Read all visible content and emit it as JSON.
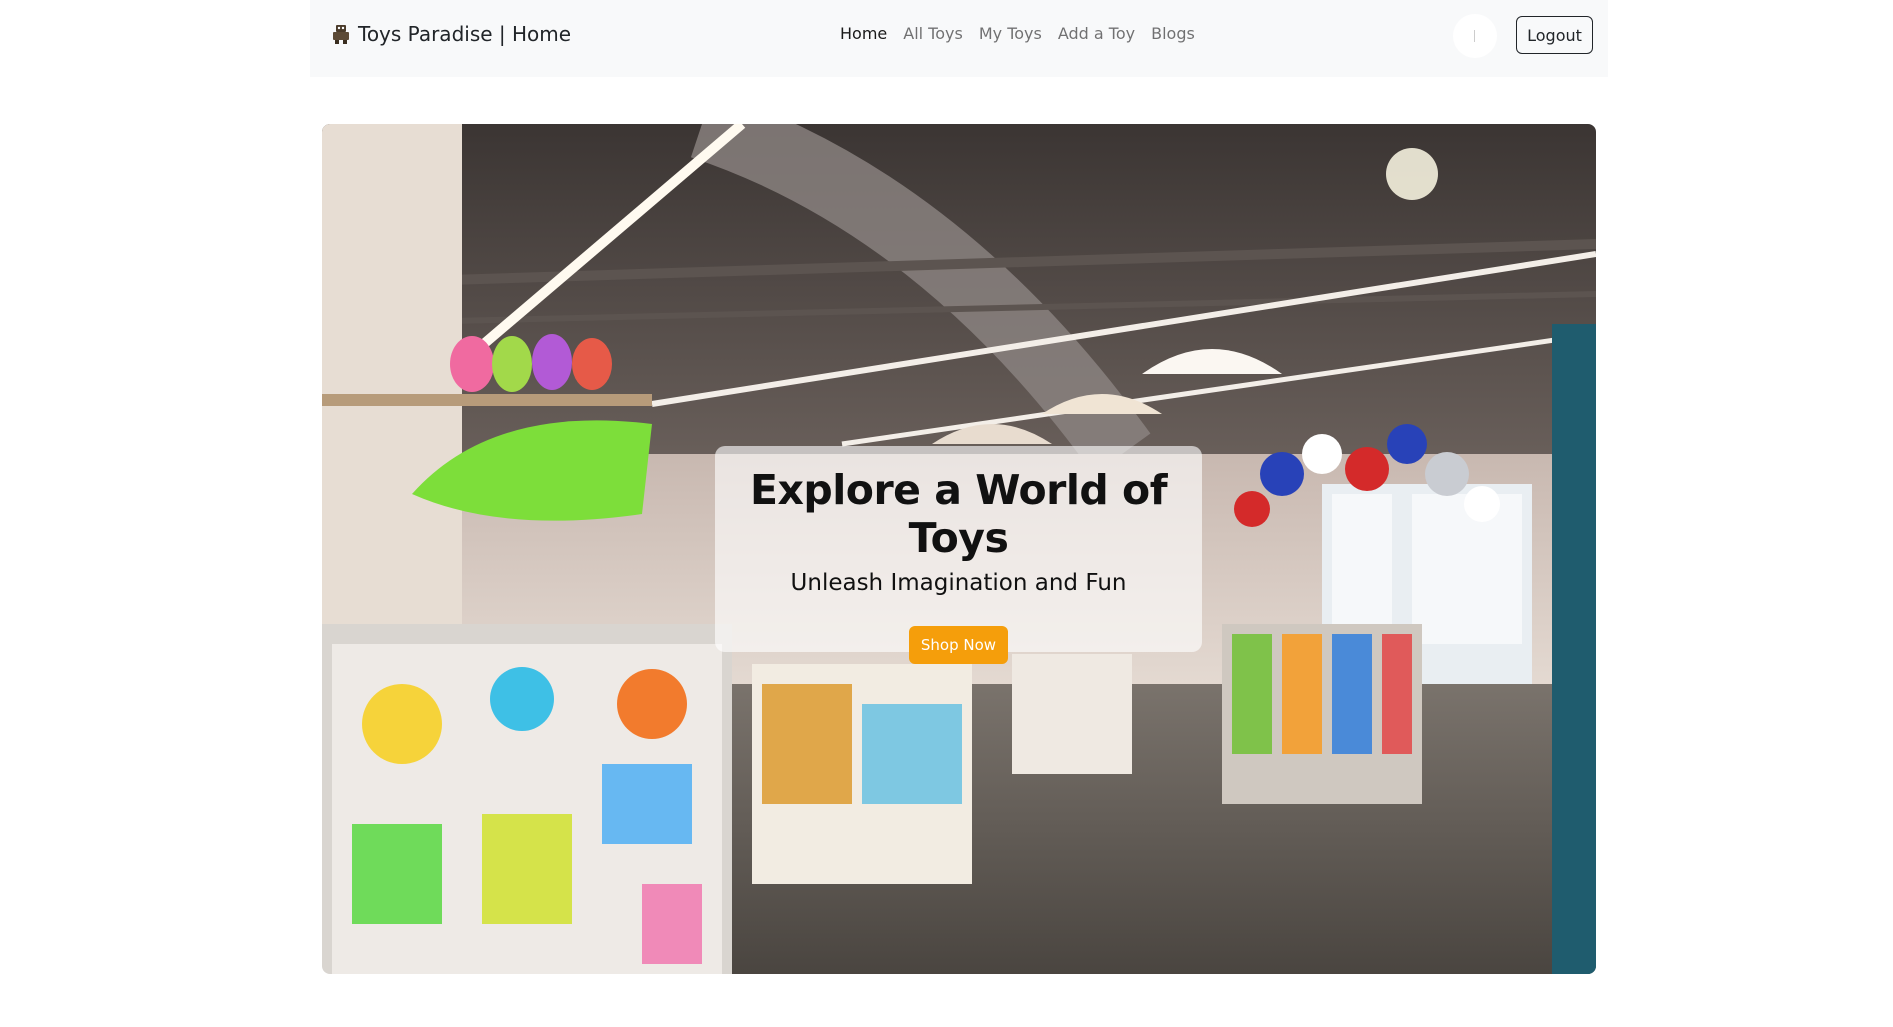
{
  "navbar": {
    "brand": "Toys Paradise | Home",
    "brand_icon": "toy-robot-icon",
    "links": [
      {
        "label": "Home",
        "active": true
      },
      {
        "label": "All Toys",
        "active": false
      },
      {
        "label": "My Toys",
        "active": false
      },
      {
        "label": "Add a Toy",
        "active": false
      },
      {
        "label": "Blogs",
        "active": false
      }
    ],
    "logout_label": "Logout"
  },
  "hero": {
    "title": "Explore a World of Toys",
    "subtitle": "Unleash Imagination and Fun",
    "cta_label": "Shop Now",
    "cta_color": "#f59e0b"
  }
}
